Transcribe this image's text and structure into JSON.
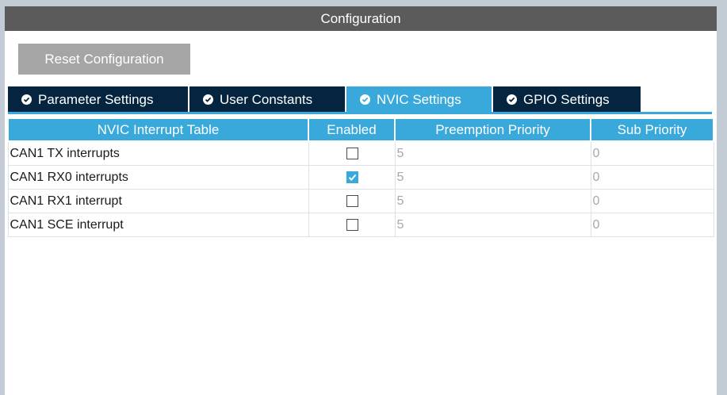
{
  "title": "Configuration",
  "reset_button": "Reset Configuration",
  "tabs": [
    {
      "label": "Parameter Settings",
      "icon": "check-circle-icon",
      "active": false
    },
    {
      "label": "User Constants",
      "icon": "check-circle-icon",
      "active": false
    },
    {
      "label": "NVIC Settings",
      "icon": "check-circle-icon",
      "active": true
    },
    {
      "label": "GPIO Settings",
      "icon": "check-circle-icon",
      "active": false
    }
  ],
  "table": {
    "headers": [
      "NVIC Interrupt Table",
      "Enabled",
      "Preemption Priority",
      "Sub Priority"
    ],
    "rows": [
      {
        "name": "CAN1 TX interrupts",
        "enabled": false,
        "preemption": "5",
        "sub": "0"
      },
      {
        "name": "CAN1 RX0 interrupts",
        "enabled": true,
        "preemption": "5",
        "sub": "0"
      },
      {
        "name": "CAN1 RX1 interrupt",
        "enabled": false,
        "preemption": "5",
        "sub": "0"
      },
      {
        "name": "CAN1 SCE interrupt",
        "enabled": false,
        "preemption": "5",
        "sub": "0"
      }
    ]
  },
  "colors": {
    "accent": "#39a9dc",
    "tab_dark": "#04243f",
    "titlebar": "#5b5b5b",
    "button": "#a5a5a5"
  }
}
